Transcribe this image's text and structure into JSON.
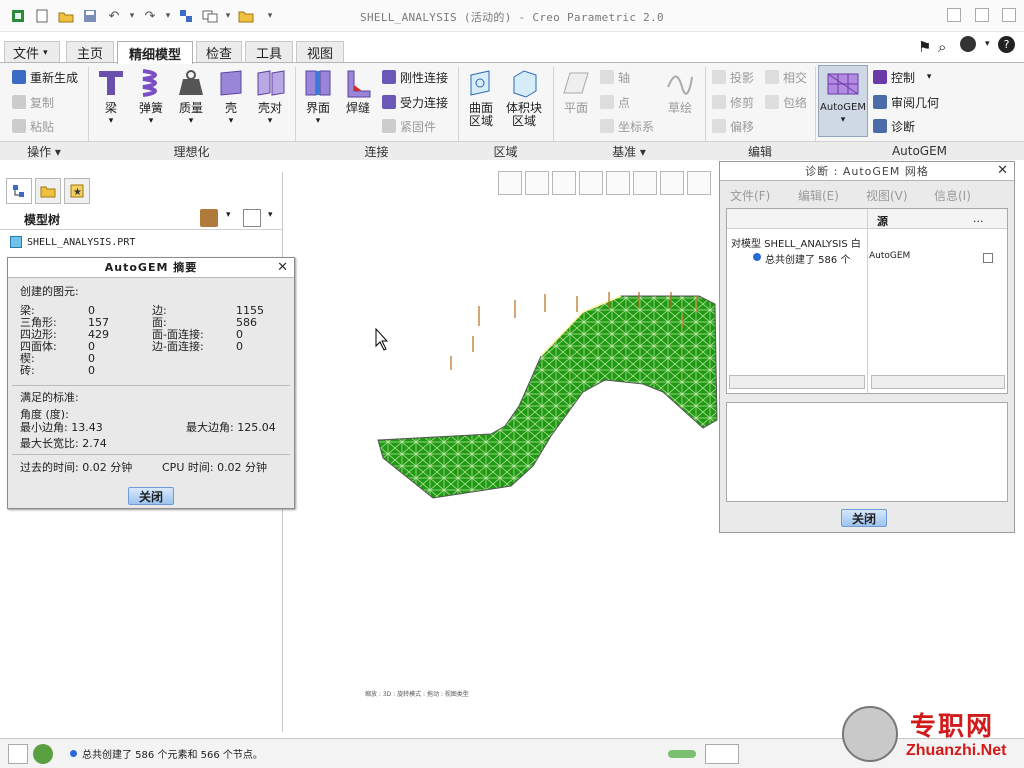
{
  "window": {
    "title": "SHELL_ANALYSIS (活动的) - Creo Parametric 2.0"
  },
  "tabs": [
    {
      "label": "文件",
      "suffix": "▾"
    },
    {
      "label": "主页"
    },
    {
      "label": "精细模型"
    },
    {
      "label": "检查"
    },
    {
      "label": "工具"
    },
    {
      "label": "视图"
    }
  ],
  "ribbon": {
    "operations": {
      "items": [
        "重新生成",
        "复制",
        "粘贴"
      ],
      "group": "操作 ▾"
    },
    "idealize": {
      "items": [
        "梁",
        "弹簧",
        "质量",
        "壳",
        "壳对"
      ],
      "group": "理想化"
    },
    "connect": {
      "items": [
        "界面",
        "焊缝",
        "刚性连接",
        "受力连接",
        "紧固件"
      ],
      "group": "连接"
    },
    "region": {
      "items": [
        "曲面\n区域",
        "体积块\n区域"
      ],
      "group": "区域"
    },
    "datum": {
      "items": [
        "平面",
        "轴",
        "点",
        "坐标系",
        "草绘"
      ],
      "group": "基准 ▾"
    },
    "edit": {
      "items": [
        "投影",
        "相交",
        "修剪",
        "包络",
        "偏移"
      ],
      "group": "编辑"
    },
    "autogem": {
      "items": [
        "AutoGEM",
        "控制",
        "审阅几何",
        "诊断"
      ],
      "group": "AutoGEM"
    }
  },
  "tree": {
    "title": "模型树",
    "root": "SHELL_ANALYSIS.PRT"
  },
  "summary_dialog": {
    "title": "AutoGEM 摘要",
    "created_heading": "创建的图元:",
    "rows_left": [
      {
        "label": "梁:",
        "value": "0"
      },
      {
        "label": "三角形:",
        "value": "157"
      },
      {
        "label": "四边形:",
        "value": "429"
      },
      {
        "label": "四面体:",
        "value": "0"
      },
      {
        "label": "楔:",
        "value": "0"
      },
      {
        "label": "砖:",
        "value": "0"
      }
    ],
    "rows_right": [
      {
        "label": "边:",
        "value": "1155"
      },
      {
        "label": "面:",
        "value": "586"
      },
      {
        "label": "面-面连接:",
        "value": "0"
      },
      {
        "label": "边-面连接:",
        "value": "0"
      }
    ],
    "criteria_heading": "满足的标准:",
    "angle_heading": "角度 (度):",
    "min_angle": "最小边角: 13.43",
    "max_angle": "最大边角: 125.04",
    "max_aspect": "最大长宽比: 2.74",
    "elapsed": "过去的时间: 0.02 分钟",
    "cpu": "CPU 时间: 0.02 分钟",
    "close_label": "关闭"
  },
  "diag_dialog": {
    "title": "诊断 : AutoGEM 网格",
    "menus": [
      "文件(F)",
      "编辑(E)",
      "视图(V)",
      "信息(I)"
    ],
    "col_source": "源",
    "col_more": "...",
    "line1": "对模型 SHELL_ANALYSIS 白",
    "line2": "总共创建了 586 个",
    "source_value": "AutoGEM",
    "close_label": "关闭"
  },
  "status": {
    "message": "总共创建了 586 个元素和 566 个节点。"
  },
  "watermark": {
    "cn": "专职网",
    "en": "Zhuanzhi.Net"
  },
  "view_caption": "缩放 : 3D : 旋转模式 : 拖动 : 视图类型",
  "colors": {
    "mesh_green": "#1f9a12",
    "accent_blue": "#6f9bd6",
    "watermark_red": "#d21a1a"
  }
}
